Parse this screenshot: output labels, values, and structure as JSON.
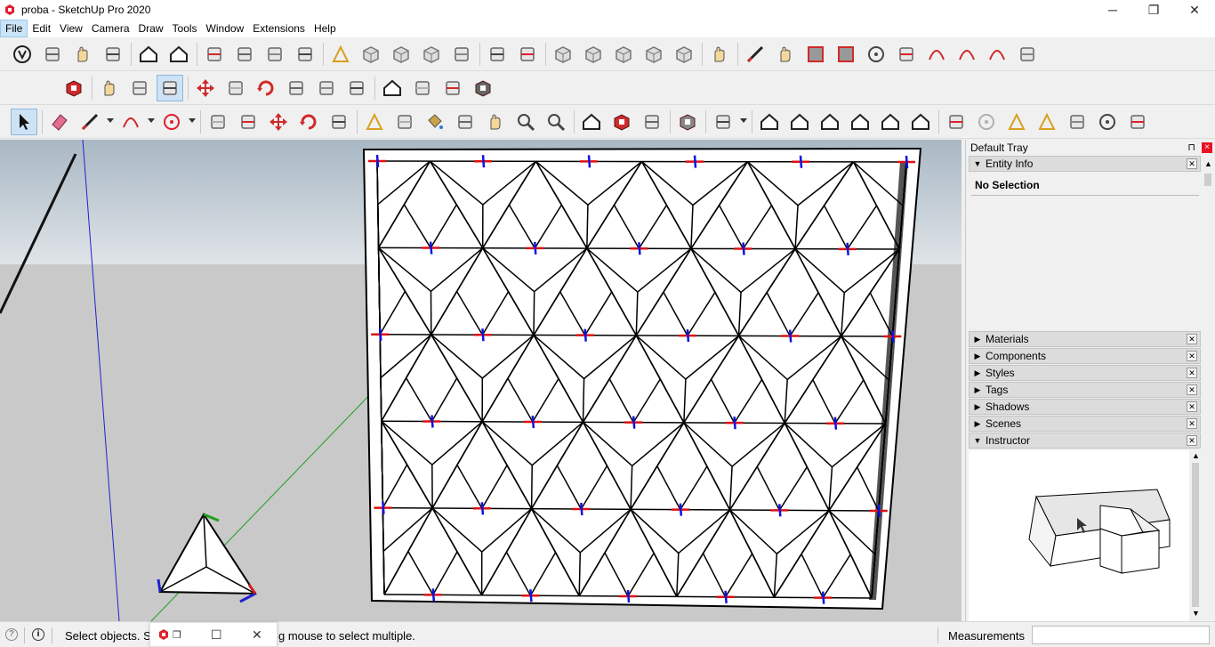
{
  "window": {
    "title": "proba - SketchUp Pro 2020",
    "minimize": "─",
    "restore": "❐",
    "close": "✕"
  },
  "menu": [
    "File",
    "Edit",
    "View",
    "Camera",
    "Draw",
    "Tools",
    "Window",
    "Extensions",
    "Help"
  ],
  "tray": {
    "title": "Default Tray",
    "pin": "⊓",
    "close": "×",
    "entity_info": {
      "label": "Entity Info",
      "selection": "No Selection"
    },
    "panels": [
      "Materials",
      "Components",
      "Styles",
      "Tags",
      "Shadows",
      "Scenes",
      "Instructor"
    ]
  },
  "statusbar": {
    "message_left": "Select objects. S",
    "message_right": "g mouse to select multiple.",
    "measurements_label": "Measurements",
    "measurements_value": ""
  },
  "colors": {
    "accent_red": "#e0202c",
    "selection_blue": "#cde2f5",
    "axis_red": "#e01010",
    "axis_green": "#10a010",
    "axis_blue": "#1010e0"
  },
  "icons": {
    "row1": [
      "sketchup-logo-icon",
      "teapot-icon",
      "hand-teapot-icon",
      "cloud-icon",
      "warehouse-upload-icon",
      "warehouse-share-icon",
      "section-plane-icon",
      "layout-icon",
      "layout-send-icon",
      "lock-icon",
      "scale-tape-icon",
      "box-icon",
      "box-arrow-icon",
      "sandbox-icon",
      "tag-icon",
      "solid-union-icon",
      "solid-subtract-icon",
      "xray-icon",
      "wireframe-icon",
      "hidden-line-icon",
      "shaded-icon",
      "monochrome-icon",
      "component-hand-icon",
      "pencil-icon",
      "freehand-icon",
      "rectangle-icon",
      "rotated-rectangle-icon",
      "circle-icon",
      "polygon-icon",
      "arc-icon",
      "two-point-arc-icon",
      "three-point-arc-icon",
      "pie-icon"
    ],
    "row2": [
      "extension-red-icon",
      "hand-pointer-icon",
      "geo-location-icon",
      "model-info-icon",
      "move-icon",
      "pushpull-icon",
      "rotate-icon",
      "followme-icon",
      "scale-icon",
      "offset-icon",
      "extension-warehouse-icon",
      "shipping-icon",
      "puzzle-icon",
      "gear-ruby-icon"
    ],
    "row3": [
      "select-arrow-icon",
      "eraser-icon",
      "pencil-draw-icon",
      "arc-draw-icon",
      "circle-draw-icon",
      "pushpull-draw-icon",
      "offset-draw-icon",
      "move-draw-icon",
      "rotate-draw-icon",
      "scale-draw-icon",
      "tape-measure-icon",
      "text-label-icon",
      "paint-bucket-icon",
      "orbit-icon",
      "pan-hand-icon",
      "zoom-icon",
      "zoom-extents-icon",
      "3d-warehouse-icon",
      "extension-manager-icon",
      "send-layout-icon",
      "ruby-icon",
      "user-account-icon",
      "iso-view-icon",
      "top-view-icon",
      "front-view-icon",
      "right-view-icon",
      "back-view-icon",
      "left-view-icon",
      "section-cut-icon",
      "rings-icon",
      "protractor-icon",
      "dimension-icon",
      "axes-icon",
      "sun-icon",
      "shadow-icon"
    ]
  }
}
